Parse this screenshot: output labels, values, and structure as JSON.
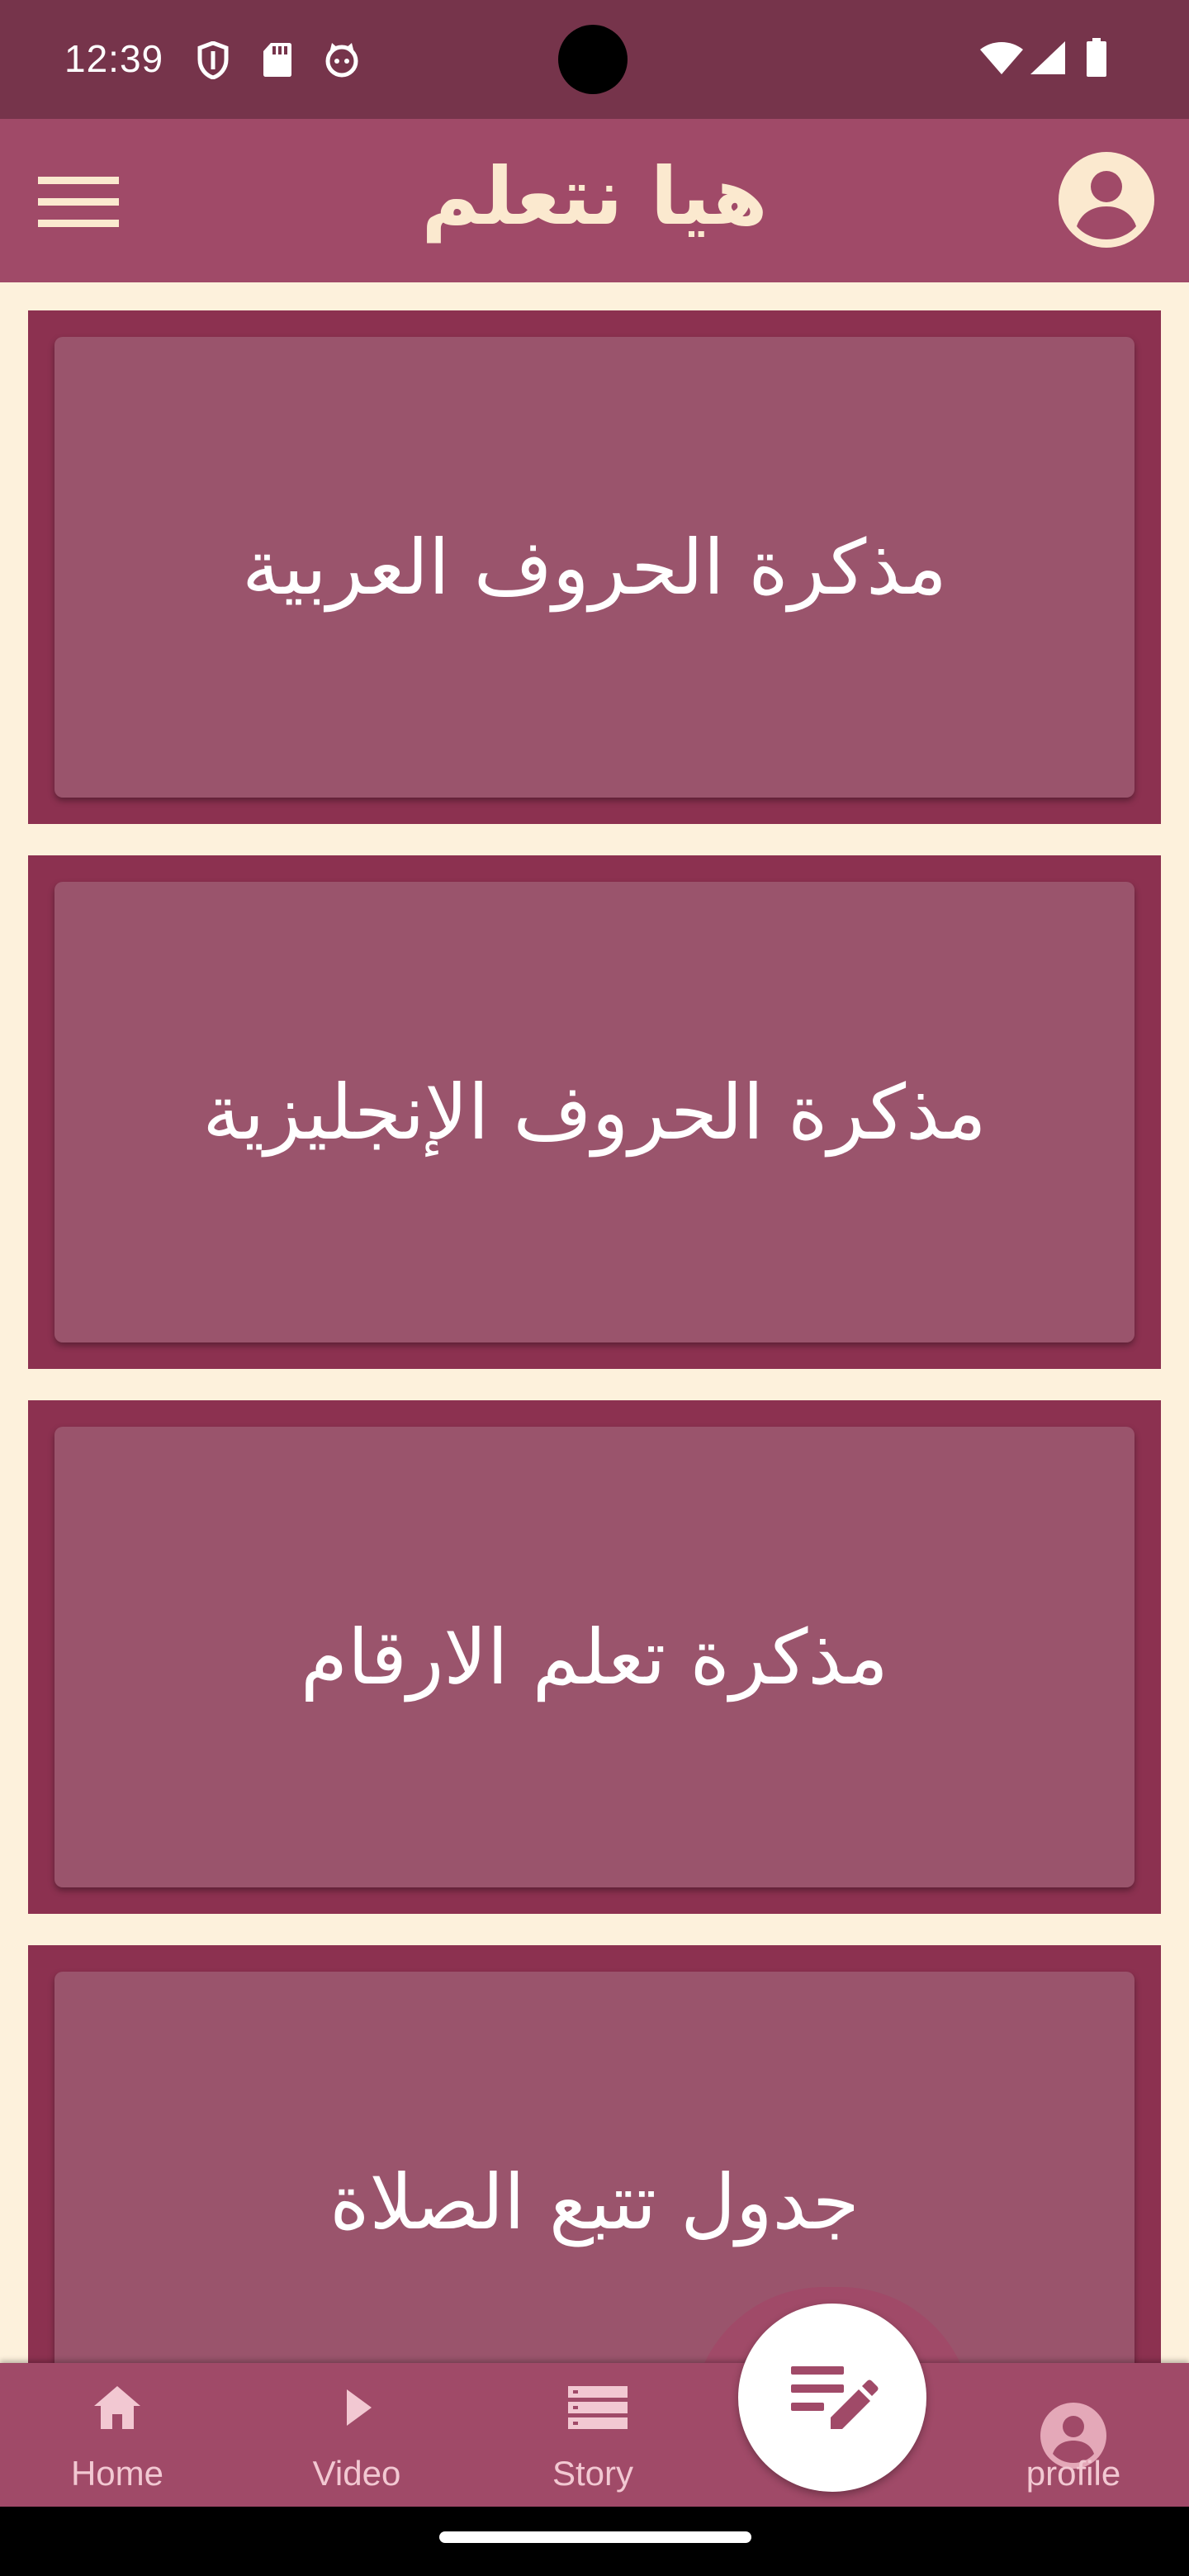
{
  "status_bar": {
    "time": "12:39",
    "icons": [
      "shield-icon",
      "sd-card-icon",
      "cat-face-icon",
      "wifi-icon",
      "cellular-signal-icon",
      "battery-icon"
    ]
  },
  "app_bar": {
    "title": "هيا نتعلم",
    "menu_icon": "hamburger-menu-icon",
    "account_icon": "account-circle-icon"
  },
  "cards": [
    {
      "label": "مذكرة الحروف العربية"
    },
    {
      "label": "مذكرة الحروف الإنجليزية"
    },
    {
      "label": "مذكرة تعلم الارقام"
    },
    {
      "label": "جدول تتبع الصلاة"
    }
  ],
  "bottom_nav": {
    "items": [
      {
        "label": "Home",
        "icon": "home-icon"
      },
      {
        "label": "Video",
        "icon": "play-icon"
      },
      {
        "label": "Story",
        "icon": "list-icon"
      },
      {
        "label": "profile",
        "icon": "account-circle-icon"
      }
    ],
    "fab_icon": "edit-note-icon"
  },
  "colors": {
    "status_bar": "#76344b",
    "app_bar": "#a04a68",
    "background": "#fdf1dc",
    "card_frame": "#8c3150",
    "card_fill": "#9a546c",
    "title_text": "#fbe9cf",
    "nav_label": "#f2c8d2"
  }
}
